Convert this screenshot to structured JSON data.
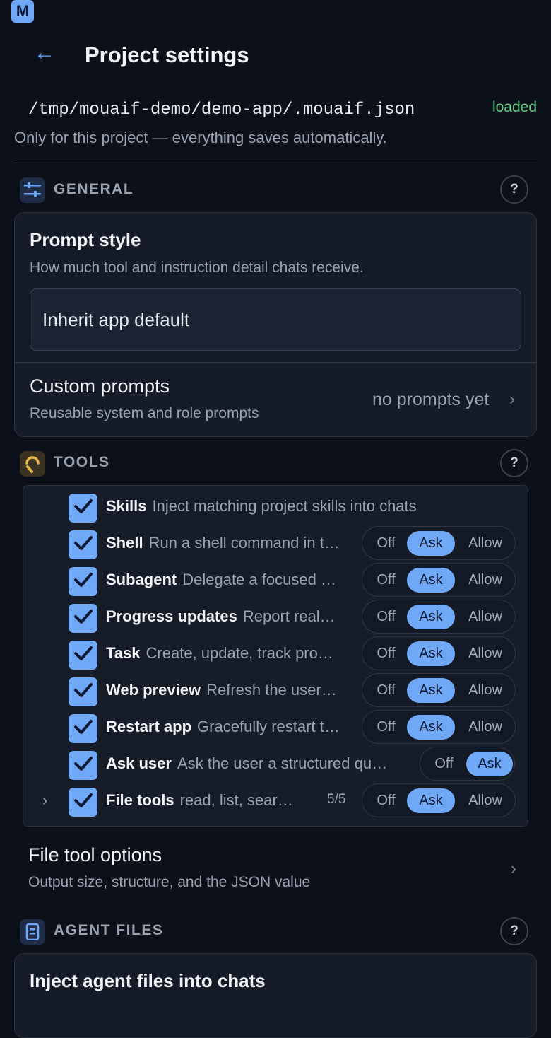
{
  "app": {
    "logo_letter": "M"
  },
  "header": {
    "back_icon": "←",
    "title": "Project settings"
  },
  "config": {
    "path": "/tmp/mouaif-demo/demo-app/.mouaif.json",
    "status": "loaded",
    "status_color": "#5ccf83",
    "note": "Only for this project — everything saves automatically."
  },
  "general": {
    "label": "GENERAL",
    "help": "?",
    "prompt_style": {
      "title": "Prompt style",
      "description": "How much tool and instruction detail chats receive.",
      "value": "Inherit app default"
    },
    "custom_prompts": {
      "title": "Custom prompts",
      "description": "Reusable system and role prompts",
      "value": "no prompts yet",
      "chevron": "›"
    }
  },
  "tools": {
    "label": "TOOLS",
    "help": "?",
    "items": [
      {
        "name": "Skills",
        "description": "Inject matching project skills into chats",
        "checked": true,
        "options": []
      },
      {
        "name": "Shell",
        "description": "Run a shell command in t…",
        "checked": true,
        "options": [
          "Off",
          "Ask",
          "Allow"
        ],
        "selected": "Ask"
      },
      {
        "name": "Subagent",
        "description": "Delegate a focused …",
        "checked": true,
        "options": [
          "Off",
          "Ask",
          "Allow"
        ],
        "selected": "Ask"
      },
      {
        "name": "Progress updates",
        "description": "Report real…",
        "checked": true,
        "options": [
          "Off",
          "Ask",
          "Allow"
        ],
        "selected": "Ask"
      },
      {
        "name": "Task",
        "description": "Create, update, track pro…",
        "checked": true,
        "options": [
          "Off",
          "Ask",
          "Allow"
        ],
        "selected": "Ask"
      },
      {
        "name": "Web preview",
        "description": "Refresh the user…",
        "checked": true,
        "options": [
          "Off",
          "Ask",
          "Allow"
        ],
        "selected": "Ask"
      },
      {
        "name": "Restart app",
        "description": "Gracefully restart t…",
        "checked": true,
        "options": [
          "Off",
          "Ask",
          "Allow"
        ],
        "selected": "Ask"
      },
      {
        "name": "Ask user",
        "description": "Ask the user a structured qu…",
        "checked": true,
        "options": [
          "Off",
          "Ask"
        ],
        "selected": "Ask"
      },
      {
        "name": "File tools",
        "description": "read, list, sear…",
        "checked": true,
        "expander": "›",
        "count": "5/5",
        "options": [
          "Off",
          "Ask",
          "Allow"
        ],
        "selected": "Ask"
      }
    ]
  },
  "file_tool_options": {
    "title": "File tool options",
    "description": "Output size, structure, and the JSON value",
    "chevron": "›"
  },
  "agent_files": {
    "label": "AGENT FILES",
    "help": "?",
    "card_title": "Inject agent files into chats"
  },
  "colors": {
    "accent": "#6ea8f7",
    "background": "#0c1019",
    "tools_icon": "#e7b84a"
  },
  "icons": {
    "general": "sliders-icon",
    "tools": "wrench-icon",
    "agent_files": "document-icon",
    "checkbox": "checkmark-icon"
  }
}
